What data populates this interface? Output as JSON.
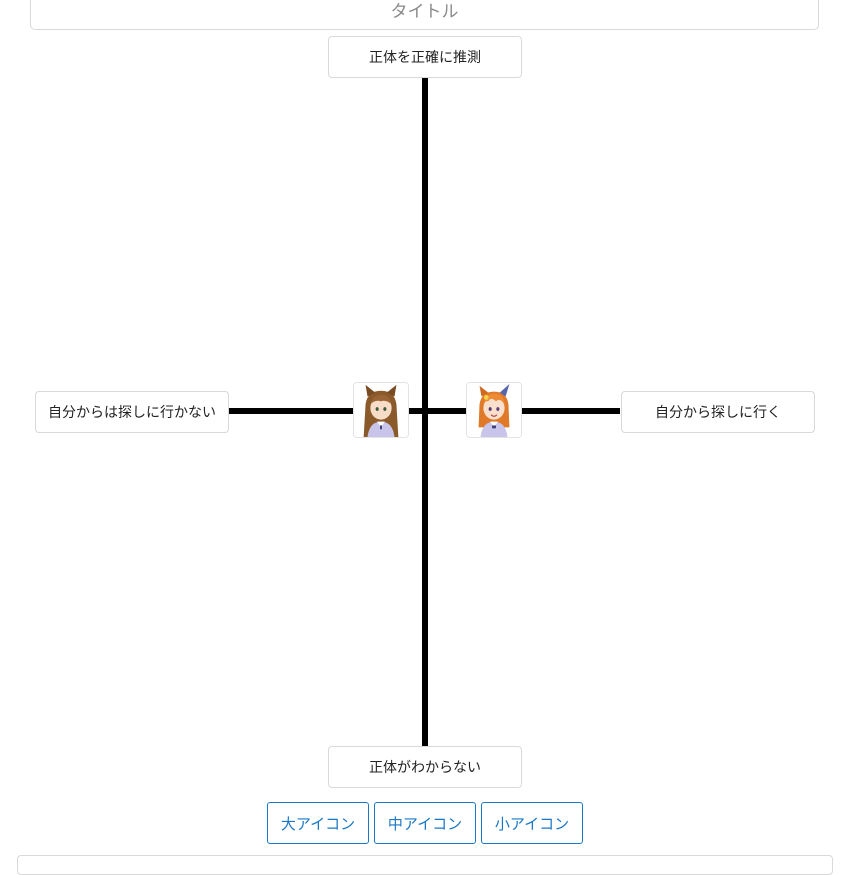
{
  "title": {
    "placeholder": "タイトル"
  },
  "axes": {
    "top": "正体を正確に推測",
    "bottom": "正体がわからない",
    "left": "自分からは探しに行かない",
    "right": "自分から探しに行く"
  },
  "characters": [
    {
      "icon": "character-portrait-brown-hair-icon",
      "hair_color": "#8b5a2b"
    },
    {
      "icon": "character-portrait-orange-hair-icon",
      "hair_color": "#e07a28"
    }
  ],
  "size_buttons": {
    "large": "大アイコン",
    "medium": "中アイコン",
    "small": "小アイコン"
  },
  "colors": {
    "accent": "#1a78c7",
    "axis": "#000000",
    "border": "#d9d9d9"
  }
}
